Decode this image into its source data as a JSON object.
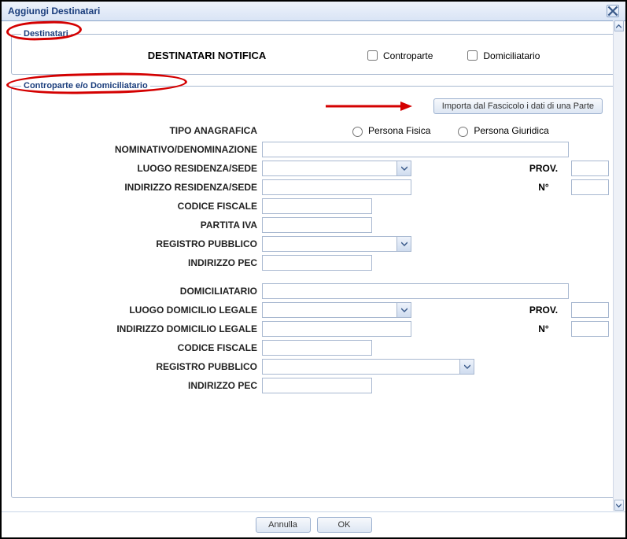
{
  "window": {
    "title": "Aggiungi Destinatari"
  },
  "group1": {
    "legend": "Destinatari",
    "notif_label": "DESTINATARI NOTIFICA",
    "chk_controparte": "Controparte",
    "chk_domiciliatario": "Domiciliatario"
  },
  "group2": {
    "legend": "Controparte e/o Domiciliatario",
    "import_btn": "Importa dal Fascicolo i dati di una Parte",
    "tipo_anagrafica": "TIPO ANAGRAFICA",
    "radio_fisica": "Persona Fisica",
    "radio_giuridica": "Persona Giuridica",
    "nominativo": "NOMINATIVO/DENOMINAZIONE",
    "luogo_residenza": "LUOGO RESIDENZA/SEDE",
    "prov": "PROV.",
    "indirizzo_residenza": "INDIRIZZO RESIDENZA/SEDE",
    "numero": "N°",
    "codice_fiscale": "CODICE FISCALE",
    "partita_iva": "PARTITA IVA",
    "registro_pubblico": "REGISTRO PUBBLICO",
    "indirizzo_pec": "INDIRIZZO PEC",
    "domiciliatario": "DOMICILIATARIO",
    "luogo_domicilio": "LUOGO DOMICILIO LEGALE",
    "indirizzo_domicilio": "INDIRIZZO DOMICILIO LEGALE",
    "codice_fiscale2": "CODICE FISCALE",
    "registro_pubblico2": "REGISTRO PUBBLICO",
    "indirizzo_pec2": "INDIRIZZO PEC"
  },
  "buttons": {
    "cancel": "Annulla",
    "ok": "OK"
  }
}
